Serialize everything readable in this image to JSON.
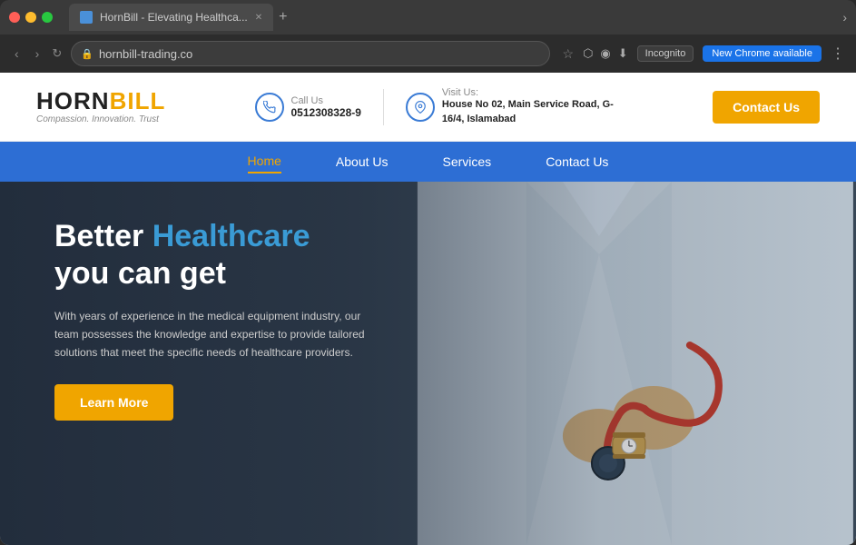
{
  "browser": {
    "title_bar": {
      "tab_title": "HornBill - Elevating Healthca...",
      "new_tab_btn": "+",
      "chevron_btn": "›"
    },
    "address_bar": {
      "back_btn": "‹",
      "forward_btn": "›",
      "refresh_btn": "↻",
      "url": "hornbill-trading.co",
      "star_label": "☆",
      "incognito_label": "Incognito",
      "chrome_update_label": "New Chrome available",
      "menu_label": "⋮"
    }
  },
  "site": {
    "header": {
      "logo": {
        "part1": "HORN",
        "part2": "BILL",
        "tagline": "Compassion. Innovation. Trust"
      },
      "call_us": {
        "label": "Call Us",
        "phone": "0512308328-9"
      },
      "visit_us": {
        "label": "Visit Us:",
        "address": "House No 02, Main Service Road, G-16/4, Islamabad"
      },
      "contact_btn": "Contact Us"
    },
    "nav": {
      "items": [
        {
          "label": "Home",
          "active": true
        },
        {
          "label": "About Us",
          "active": false
        },
        {
          "label": "Services",
          "active": false
        },
        {
          "label": "Contact Us",
          "active": false
        }
      ]
    },
    "hero": {
      "title_line1_plain": "Better ",
      "title_line1_highlight": "Healthcare",
      "title_line2": "you can get",
      "description": "With years of experience in the medical equipment industry, our team possesses the knowledge and expertise to provide tailored solutions that meet the specific needs of healthcare providers.",
      "cta_btn": "Learn More"
    }
  }
}
